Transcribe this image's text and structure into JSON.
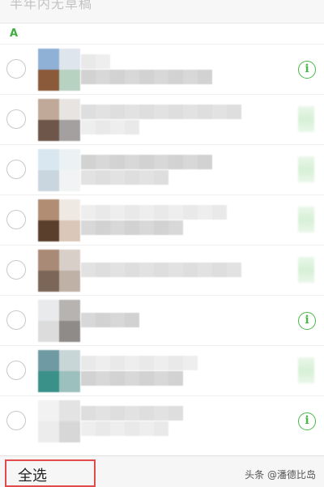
{
  "top_note": "半年内无草稿",
  "section_letter": "A",
  "contacts": [
    {
      "avatar": [
        "#8fb1d6",
        "#dfe5ec",
        "#8a5a3a",
        "#b7d2c0"
      ],
      "has_info_icon": true
    },
    {
      "avatar": [
        "#c0a999",
        "#e8e4e2",
        "#6e564b",
        "#a4a0a0"
      ],
      "has_info_icon": false
    },
    {
      "avatar": [
        "#d9e7f0",
        "#ecf1f4",
        "#c9d6df",
        "#f1f3f4"
      ],
      "has_info_icon": false
    },
    {
      "avatar": [
        "#b18d73",
        "#efe9e4",
        "#5b3f2d",
        "#dac7b9"
      ],
      "has_info_icon": false
    },
    {
      "avatar": [
        "#a98a77",
        "#d8cfc8",
        "#7c6658",
        "#bfb1a6"
      ],
      "has_info_icon": false
    },
    {
      "avatar": [
        "#e9eaeb",
        "#b6b3b0",
        "#dcdcdc",
        "#8e8b88"
      ],
      "has_info_icon": true
    },
    {
      "avatar": [
        "#6f9aa3",
        "#c8d6d7",
        "#3a9189",
        "#9cc0bd"
      ],
      "has_info_icon": false
    },
    {
      "avatar": [
        "#f2f2f2",
        "#e3e3e3",
        "#ececec",
        "#d7d7d7"
      ],
      "has_info_icon": true
    }
  ],
  "info_icon_glyph": "i",
  "select_all_label": "全选",
  "watermark": "头条 @潘德比岛",
  "colors": {
    "accent_green": "#4cb64c",
    "highlight_red": "#e14b4b"
  }
}
